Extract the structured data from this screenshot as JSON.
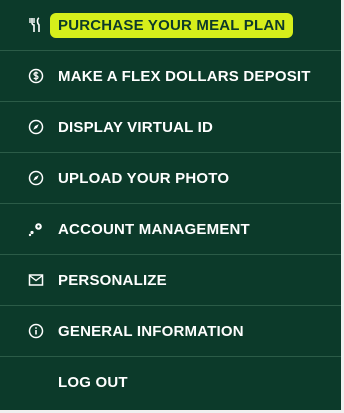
{
  "menu": {
    "items": [
      {
        "icon": "utensils-icon",
        "label": "PURCHASE YOUR MEAL PLAN",
        "highlighted": true
      },
      {
        "icon": "dollar-circle-icon",
        "label": "MAKE A FLEX DOLLARS DEPOSIT"
      },
      {
        "icon": "compass-icon",
        "label": "DISPLAY VIRTUAL ID"
      },
      {
        "icon": "compass-icon",
        "label": "UPLOAD YOUR PHOTO"
      },
      {
        "icon": "key-icon",
        "label": "ACCOUNT MANAGEMENT"
      },
      {
        "icon": "envelope-icon",
        "label": "PERSONALIZE"
      },
      {
        "icon": "info-circle-icon",
        "label": "GENERAL INFORMATION"
      },
      {
        "icon": "",
        "label": "LOG OUT"
      }
    ]
  },
  "colors": {
    "background": "#0c3a2a",
    "divider": "#2b5b47",
    "text": "#ffffff",
    "highlight": "#d6ef1b"
  }
}
